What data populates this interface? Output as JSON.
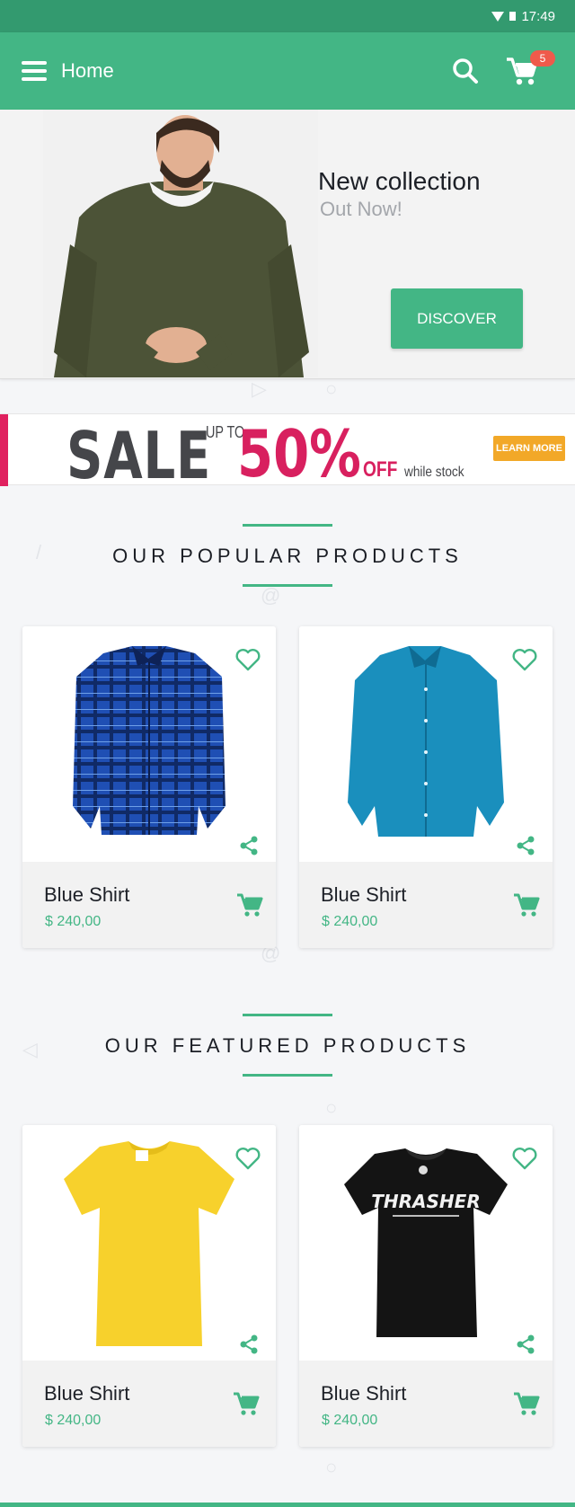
{
  "status_bar": {
    "time": "17:49"
  },
  "app_bar": {
    "title": "Home",
    "cart_count": "5"
  },
  "hero": {
    "title": "New collection",
    "subtitle": "Out Now!",
    "button": "DISCOVER"
  },
  "sale_banner": {
    "sale": "SALE",
    "upto": "UP TO",
    "percent": "50%",
    "off": "OFF",
    "while_stock": "while stock",
    "learn_more": "LEARN MORE"
  },
  "sections": {
    "popular": "OUR POPULAR PRODUCTS",
    "featured": "OUR FEATURED PRODUCTS"
  },
  "products": [
    {
      "name": "Blue Shirt",
      "price": "$ 240,00",
      "image": "plaid-blue-shirt"
    },
    {
      "name": "Blue Shirt",
      "price": "$ 240,00",
      "image": "teal-blue-shirt"
    },
    {
      "name": "Blue Shirt",
      "price": "$ 240,00",
      "image": "yellow-tshirt"
    },
    {
      "name": "Blue Shirt",
      "price": "$ 240,00",
      "image": "black-thrasher-tshirt"
    }
  ],
  "colors": {
    "primary": "#43b685",
    "status": "#339a6f",
    "sale_pink": "#d8205f",
    "badge": "#ef5a4b"
  }
}
